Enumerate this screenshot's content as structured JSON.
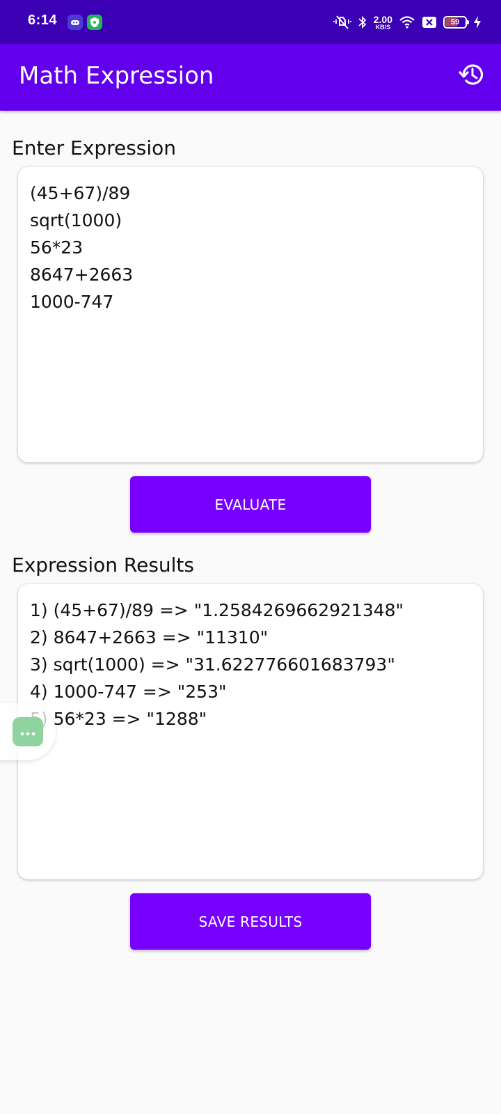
{
  "status_bar": {
    "time": "6:14",
    "net_speed_value": "2.00",
    "net_speed_unit": "KB/S",
    "battery_level": "59",
    "icons": [
      "game-icon",
      "shield-app-icon",
      "mute-vibrate-icon",
      "bluetooth-icon",
      "wifi-icon",
      "sim-x-icon",
      "battery-icon",
      "charging-icon"
    ]
  },
  "app_bar": {
    "title": "Math Expression",
    "history_icon": "history-icon"
  },
  "input_section": {
    "label": "Enter Expression",
    "value": "(45+67)/89\nsqrt(1000)\n56*23\n8647+2663\n1000-747",
    "evaluate_label": "EVALUATE"
  },
  "results_section": {
    "label": "Expression Results",
    "value": "1) (45+67)/89 => \"1.2584269662921348\"\n2) 8647+2663 => \"11310\"\n3) sqrt(1000) => \"31.622776601683793\"\n4) 1000-747 => \"253\"\n5) 56*23 => \"1288\"",
    "save_label": "SAVE RESULTS"
  },
  "floating_button": {
    "icon": "more-dots-icon"
  },
  "colors": {
    "status_bar": "#3b00b3",
    "app_bar": "#6200ee",
    "button": "#7700ff",
    "background": "#fafafa",
    "floating_button": "#8fd4a0"
  }
}
